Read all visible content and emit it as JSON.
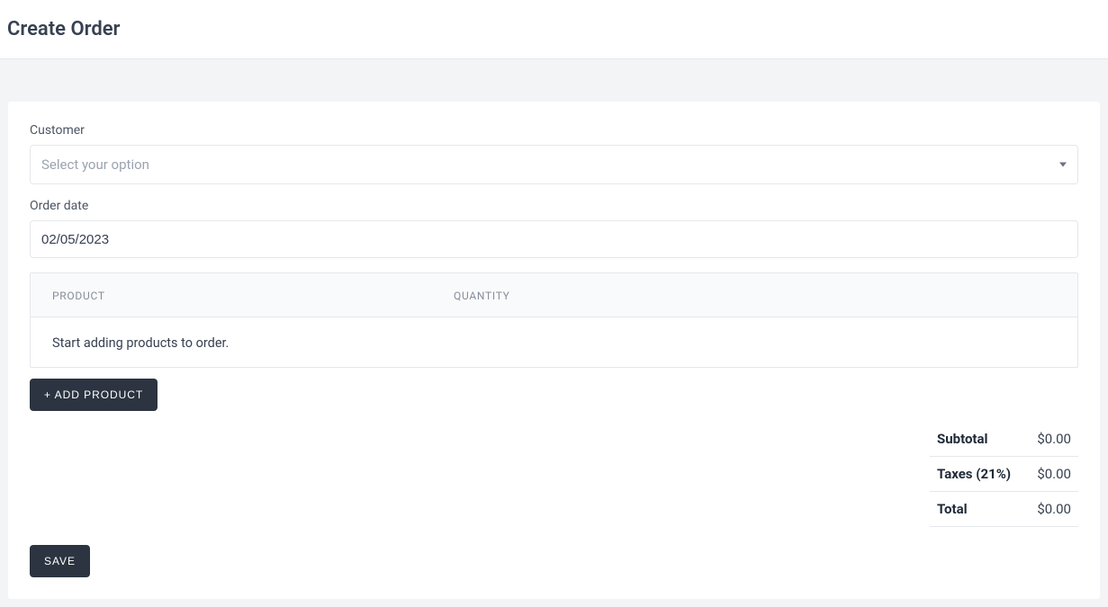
{
  "header": {
    "title": "Create Order"
  },
  "form": {
    "customer_label": "Customer",
    "customer_placeholder": "Select your option",
    "order_date_label": "Order date",
    "order_date_value": "02/05/2023"
  },
  "products_table": {
    "headers": {
      "product": "PRODUCT",
      "quantity": "QUANTITY"
    },
    "empty_message": "Start adding products to order."
  },
  "actions": {
    "add_product": "+ ADD PRODUCT",
    "save": "SAVE"
  },
  "totals": {
    "subtotal_label": "Subtotal",
    "subtotal_value": "$0.00",
    "taxes_label": "Taxes (21%)",
    "taxes_value": "$0.00",
    "total_label": "Total",
    "total_value": "$0.00"
  }
}
